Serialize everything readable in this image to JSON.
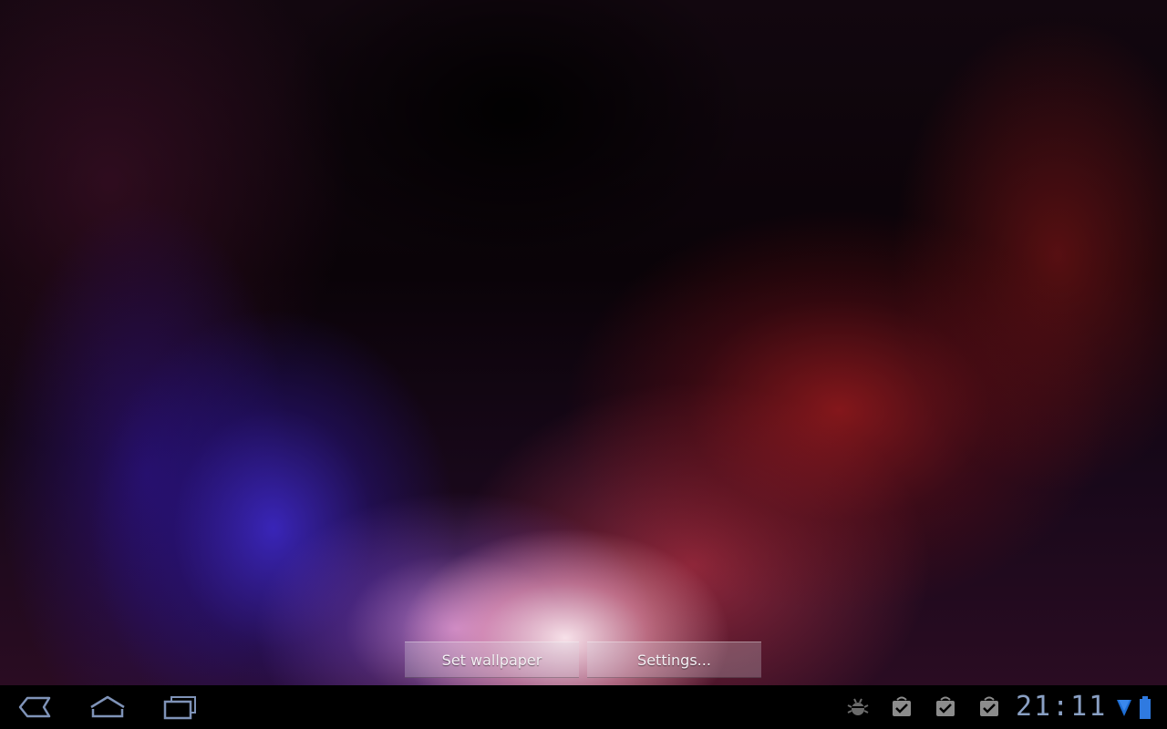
{
  "wallpaper_preview": {
    "set_wallpaper_label": "Set wallpaper",
    "settings_label": "Settings..."
  },
  "system_bar": {
    "nav": {
      "back_icon": "back-icon",
      "home_icon": "home-icon",
      "recent_apps_icon": "recent-apps-icon"
    },
    "notifications": [
      "debug-icon",
      "download-complete-icon",
      "download-complete-icon",
      "download-complete-icon"
    ],
    "clock": "21:11",
    "wifi_icon": "wifi-icon",
    "battery_icon": "battery-icon"
  },
  "colors": {
    "system_bar_bg": "#000000",
    "icon_color": "#7f93b8",
    "button_bg": "rgba(220,215,225,0.28)"
  }
}
